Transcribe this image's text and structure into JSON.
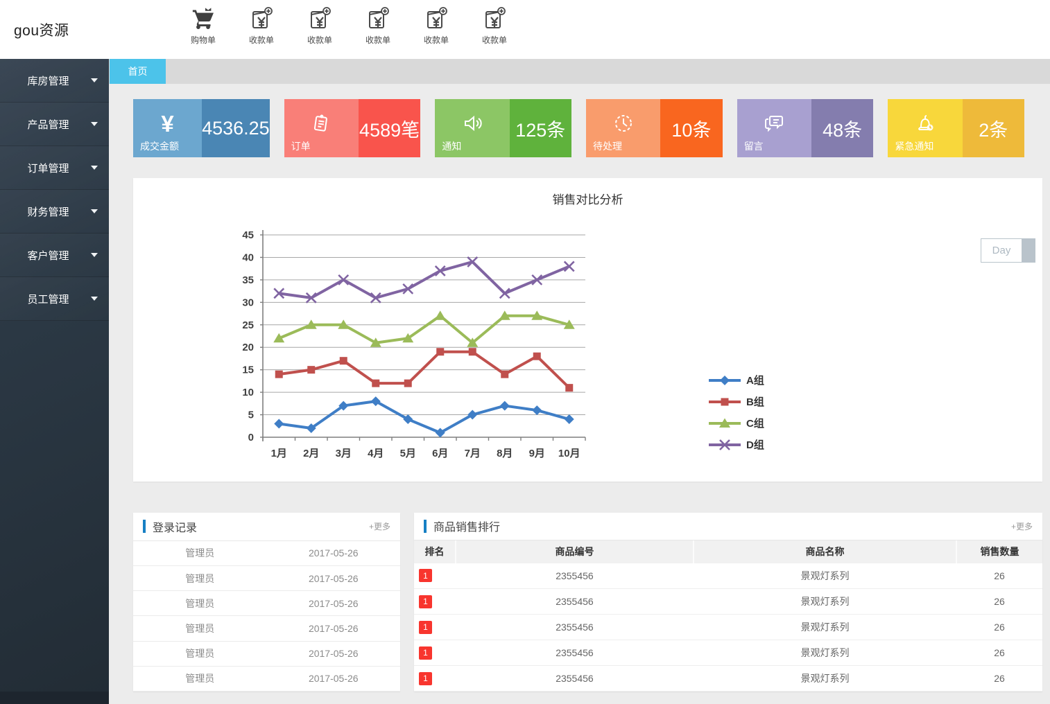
{
  "colors": {
    "accent": "#1780c4",
    "tab_blue": "#4cc3ea",
    "badge_red": "#f8352e",
    "sidebar_dark": "#2b3844"
  },
  "header": {
    "logo": "gou资源",
    "shortcuts": [
      {
        "label": "购物单",
        "icon": "cart-icon"
      },
      {
        "label": "收款单",
        "icon": "receipt-icon"
      },
      {
        "label": "收款单",
        "icon": "receipt-icon"
      },
      {
        "label": "收款单",
        "icon": "receipt-icon"
      },
      {
        "label": "收款单",
        "icon": "receipt-icon"
      },
      {
        "label": "收款单",
        "icon": "receipt-icon"
      }
    ]
  },
  "sidebar": {
    "items": [
      {
        "label": "库房管理"
      },
      {
        "label": "产品管理"
      },
      {
        "label": "订单管理"
      },
      {
        "label": "财务管理"
      },
      {
        "label": "客户管理"
      },
      {
        "label": "员工管理"
      }
    ]
  },
  "tabs": [
    {
      "label": "首页",
      "active": true
    }
  ],
  "stats": [
    {
      "label": "成交金额",
      "value": "4536.25",
      "icon": "yen-icon",
      "left_color": "#6ca7cf",
      "right_color": "#4a86b4"
    },
    {
      "label": "订单",
      "value": "4589笔",
      "icon": "order-icon",
      "left_color": "#f97f78",
      "right_color": "#f9544c"
    },
    {
      "label": "通知",
      "value": "125条",
      "icon": "speaker-icon",
      "left_color": "#8cc665",
      "right_color": "#5fb23c"
    },
    {
      "label": "待处理",
      "value": "10条",
      "icon": "clock-icon",
      "left_color": "#f99c6c",
      "right_color": "#f9661f"
    },
    {
      "label": "留言",
      "value": "48条",
      "icon": "message-icon",
      "left_color": "#a8a0d0",
      "right_color": "#847dae"
    },
    {
      "label": "紧急通知",
      "value": "2条",
      "icon": "alarm-icon",
      "left_color": "#f8d73b",
      "right_color": "#eeba3a"
    }
  ],
  "chart_panel": {
    "title": "销售对比分析",
    "period_button": "Day"
  },
  "chart_data": {
    "type": "line",
    "title": "销售对比分析",
    "categories": [
      "1月",
      "2月",
      "3月",
      "4月",
      "5月",
      "6月",
      "7月",
      "8月",
      "9月",
      "10月"
    ],
    "series": [
      {
        "name": "A组",
        "marker": "diamond",
        "color": "#3f7ec6",
        "values": [
          3,
          2,
          7,
          8,
          4,
          1,
          5,
          7,
          6,
          4
        ]
      },
      {
        "name": "B组",
        "marker": "square",
        "color": "#c0504d",
        "values": [
          14,
          15,
          17,
          12,
          12,
          19,
          19,
          14,
          18,
          11
        ]
      },
      {
        "name": "C组",
        "marker": "triangle",
        "color": "#9bbb59",
        "values": [
          22,
          25,
          25,
          21,
          22,
          27,
          21,
          27,
          27,
          25
        ]
      },
      {
        "name": "D组",
        "marker": "x",
        "color": "#8064a2",
        "values": [
          32,
          31,
          35,
          31,
          33,
          37,
          39,
          32,
          35,
          38
        ]
      }
    ],
    "xlabel": "",
    "ylabel": "",
    "ylim": [
      0,
      45
    ],
    "ystep": 5,
    "grid": true,
    "legend_position": "right"
  },
  "login_panel": {
    "title": "登录记录",
    "more": "+更多",
    "rows": [
      {
        "user": "管理员",
        "date": "2017-05-26"
      },
      {
        "user": "管理员",
        "date": "2017-05-26"
      },
      {
        "user": "管理员",
        "date": "2017-05-26"
      },
      {
        "user": "管理员",
        "date": "2017-05-26"
      },
      {
        "user": "管理员",
        "date": "2017-05-26"
      },
      {
        "user": "管理员",
        "date": "2017-05-26"
      }
    ]
  },
  "sales_panel": {
    "title": "商品销售排行",
    "more": "+更多",
    "columns": [
      "排名",
      "商品编号",
      "商品名称",
      "销售数量"
    ],
    "rows": [
      {
        "rank": "1",
        "code": "2355456",
        "name": "景观灯系列",
        "qty": "26"
      },
      {
        "rank": "1",
        "code": "2355456",
        "name": "景观灯系列",
        "qty": "26"
      },
      {
        "rank": "1",
        "code": "2355456",
        "name": "景观灯系列",
        "qty": "26"
      },
      {
        "rank": "1",
        "code": "2355456",
        "name": "景观灯系列",
        "qty": "26"
      },
      {
        "rank": "1",
        "code": "2355456",
        "name": "景观灯系列",
        "qty": "26"
      }
    ]
  }
}
